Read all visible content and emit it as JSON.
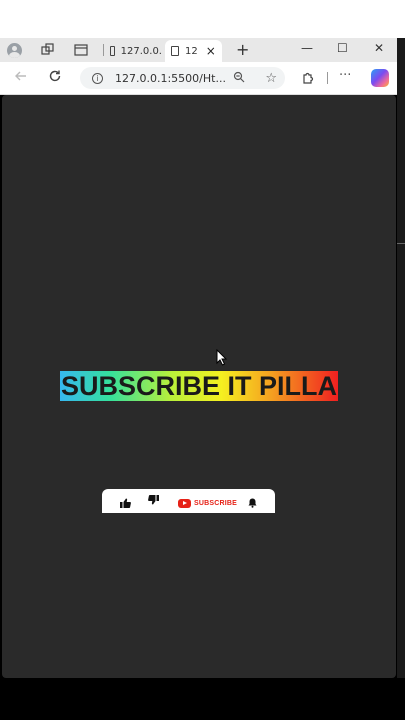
{
  "browser": {
    "tabs": [
      {
        "label": "127.0.0."
      },
      {
        "label": "12",
        "close": "×"
      }
    ],
    "new_tab": "+",
    "window": {
      "minimize": "—",
      "maximize": "☐",
      "close": "✕"
    },
    "address": {
      "url": "127.0.0.1:5500/Ht..."
    },
    "menu": "···"
  },
  "page": {
    "headline": "SUBSCRIBE IT PILLA",
    "subscribe_bar": {
      "subscribe_label": "SUBSCRIBE"
    }
  },
  "colors": {
    "page_bg": "#2a2a2a",
    "youtube_red": "#e62117",
    "gradient": [
      "#36b7f0",
      "#35e09c",
      "#b9f03a",
      "#f5f020",
      "#f5a020",
      "#f02020"
    ]
  }
}
